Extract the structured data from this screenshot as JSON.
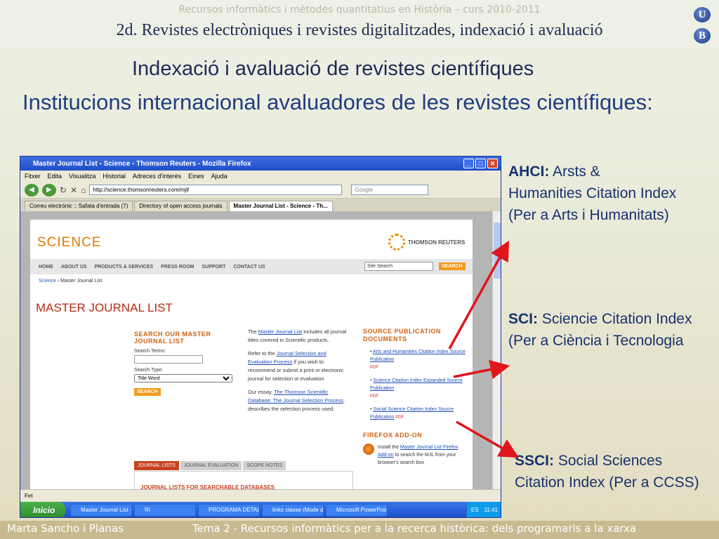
{
  "header": {
    "course": "Recursos informàtics i mètodes quantitatius en Història – curs 2010-2011",
    "subtitle": "2d. Revistes electròniques i revistes digitalitzades, indexació i avaluació",
    "logo_u": "U",
    "logo_b": "B"
  },
  "slide": {
    "title": "Indexació i avaluació de revistes científiques",
    "heading": "Institucions internacional avaluadores de les revistes científiques:"
  },
  "browser": {
    "window_title": "Master Journal List - Science - Thomson Reuters - Mozilla Firefox",
    "menu": [
      "Fitxer",
      "Edita",
      "Visualitza",
      "Historial",
      "Adreces d'interès",
      "Eines",
      "Ajuda"
    ],
    "url": "http://science.thomsonreuters.com/mjl/",
    "search_placeholder": "Google",
    "tabs": [
      "Correu electrònic :: Safata d'entrada (7)",
      "Directory of open access journals",
      "Master Journal List - Science - Th..."
    ],
    "status": "Fet"
  },
  "page": {
    "logo": "SCIENCE",
    "brand": "THOMSON REUTERS",
    "nav": [
      "HOME",
      "ABOUT US",
      "PRODUCTS & SERVICES",
      "PRESS ROOM",
      "SUPPORT",
      "CONTACT US"
    ],
    "site_search": "Site Search",
    "search_btn": "SEARCH",
    "breadcrumb_root": "Science",
    "breadcrumb_current": " › Master Journal List",
    "title": "MASTER JOURNAL LIST",
    "search_heading": "SEARCH OUR MASTER JOURNAL LIST",
    "search_terms_label": "Search Terms:",
    "search_type_label": "Search Type:",
    "search_type_value": "Title Word",
    "search_submit": "SEARCH",
    "intro_1a": "The ",
    "intro_1b": "Master Journal List",
    "intro_1c": " includes all journal titles covered in Scientific products.",
    "intro_2a": "Refer to the ",
    "intro_2b": "Journal Selection and Evaluation Process",
    "intro_2c": " if you wish to recommend or submit a print or electronic journal for selection or evaluation",
    "intro_3a": "Our essay, ",
    "intro_3b": "The Thomson Scientific Database: The Journal Selection Process",
    "intro_3c": ", describes the selection process used.",
    "source_heading": "SOURCE PUBLICATION DOCUMENTS",
    "sources": [
      {
        "label": "Arts and Humanities Citation Index Source Publication",
        "pdf": "PDF"
      },
      {
        "label": "Science Citation Index Expanded Source Publication",
        "pdf": "PDF"
      },
      {
        "label": "Social Science Citation Index Source Publication",
        "pdf": "PDF"
      }
    ],
    "addon_heading": "FIREFOX ADD-ON",
    "addon_a": "Install the ",
    "addon_b": "Master Journal List Firefox Add-on",
    "addon_c": " to search the MJL from your browser's search box",
    "bottom_tabs": [
      "JOURNAL LISTS",
      "JOURNAL EVALUATION",
      "SCOPE NOTES"
    ],
    "lists_heading": "JOURNAL LISTS FOR SEARCHABLE DATABASES"
  },
  "taskbar": {
    "start": "Inicio",
    "items": [
      "Master Journal List - ...",
      "RI",
      "PROGRAMA DETALLA...",
      "links classe (Mode de ...",
      "Microsoft PowerPoint..."
    ],
    "lang": "ES",
    "time": "11:41"
  },
  "notes": {
    "ahci_label": "AHCI:",
    "ahci_text": " Arsts & Humanities Citation Index (Per a Arts i Humanitats)",
    "sci_label": "SCI:",
    "sci_text": " Sciencie Citation Index (Per a Ciència i Tecnologia",
    "ssci_label": "SSCI:",
    "ssci_text": "  Social Sciences Citation Index (Per a CCSS)"
  },
  "footer": {
    "author": "Marta Sancho i Planas",
    "topic": "Tema 2 - Recursos informàtics per a la recerca històrica: dels programaris a la xarxa"
  },
  "colors": {
    "arrow": "#e0161c",
    "title": "#213d80",
    "footer_bar": "#c9b990"
  }
}
